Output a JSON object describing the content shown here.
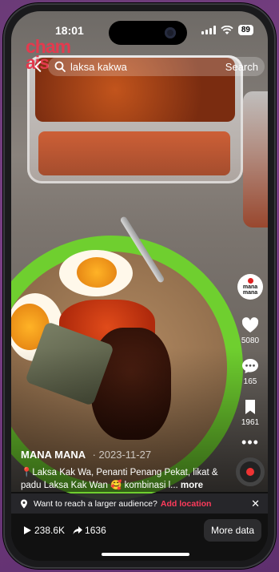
{
  "status_bar": {
    "time": "18:01",
    "battery": "89"
  },
  "brand": {
    "logo_line1": "cham",
    "logo_line2": "ais",
    "color": "#e33a4e"
  },
  "search": {
    "query": "laksa kakwa",
    "button_label": "Search"
  },
  "rail": {
    "avatar_label": "mana mana",
    "likes": "5080",
    "comments": "165",
    "saves": "1961"
  },
  "caption": {
    "author": "MANA MANA",
    "date": "· 2023-11-27",
    "description": "📍Laksa Kak Wa, Penanti Penang Pekat, likat & padu Laksa Kak Wan 🥰 kombinasi l...",
    "more_label": " more"
  },
  "promo": {
    "text": "Want to reach a larger audience?",
    "link": "Add location",
    "link_color": "#ff3b5c"
  },
  "stats": {
    "views": "238.6K",
    "shares": "1636",
    "more_data_label": "More data"
  }
}
